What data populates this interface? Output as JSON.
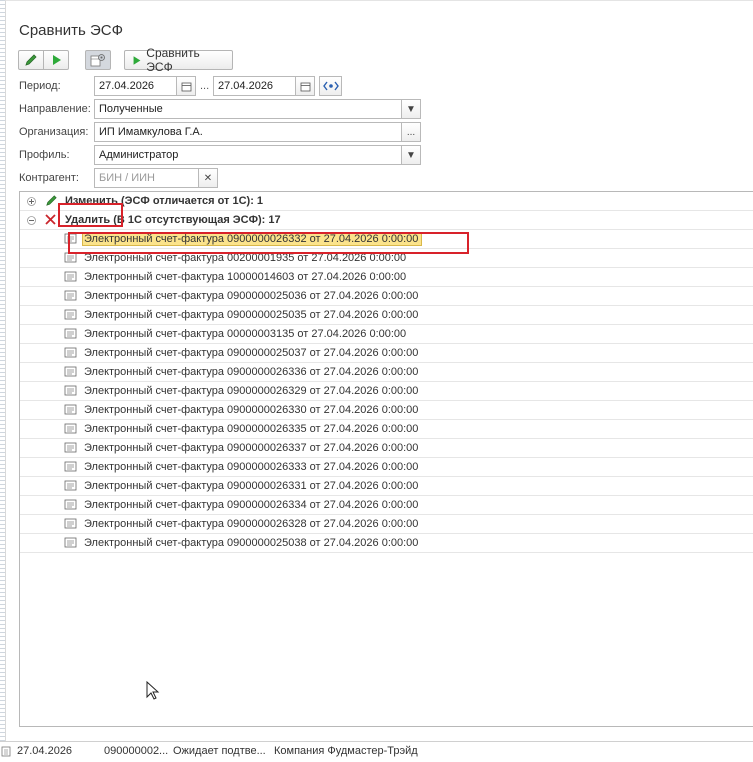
{
  "window": {
    "title": "Сравнить ЭСФ"
  },
  "toolbar": {
    "compare_label": "Сравнить ЭСФ"
  },
  "filters": {
    "period_label": "Период:",
    "period_from": "27.04.2026",
    "period_to": "27.04.2026",
    "period_sep": "...",
    "direction_label": "Направление:",
    "direction_value": "Полученные",
    "org_label": "Организация:",
    "org_value": "ИП Имамкулова Г.А.",
    "profile_label": "Профиль:",
    "profile_value": "Администратор",
    "counterparty_label": "Контрагент:",
    "counterparty_placeholder": "БИН / ИИН"
  },
  "tree": {
    "groups": [
      {
        "label": "Изменить (ЭСФ отличается от 1С): 1",
        "expanded": false
      },
      {
        "label": "Удалить (В 1С отсутствующая ЭСФ): 17",
        "expanded": true
      }
    ],
    "items": [
      "Электронный счет-фактура 0900000026332 от 27.04.2026 0:00:00",
      "Электронный счет-фактура 00200001935 от 27.04.2026 0:00:00",
      "Электронный счет-фактура 10000014603 от 27.04.2026 0:00:00",
      "Электронный счет-фактура 0900000025036 от 27.04.2026 0:00:00",
      "Электронный счет-фактура 0900000025035 от 27.04.2026 0:00:00",
      "Электронный счет-фактура 00000003135 от 27.04.2026 0:00:00",
      "Электронный счет-фактура 0900000025037 от 27.04.2026 0:00:00",
      "Электронный счет-фактура 0900000026336 от 27.04.2026 0:00:00",
      "Электронный счет-фактура 0900000026329 от 27.04.2026 0:00:00",
      "Электронный счет-фактура 0900000026330 от 27.04.2026 0:00:00",
      "Электронный счет-фактура 0900000026335 от 27.04.2026 0:00:00",
      "Электронный счет-фактура 0900000026337 от 27.04.2026 0:00:00",
      "Электронный счет-фактура 0900000026333 от 27.04.2026 0:00:00",
      "Электронный счет-фактура 0900000026331 от 27.04.2026 0:00:00",
      "Электронный счет-фактура 0900000026334 от 27.04.2026 0:00:00",
      "Электронный счет-фактура 0900000026328 от 27.04.2026 0:00:00",
      "Электронный счет-фактура 0900000025038 от 27.04.2026 0:00:00"
    ]
  },
  "statusbar": {
    "date": "27.04.2026",
    "number": "090000002...",
    "status": "Ожидает подтве...",
    "company": "Компания Фудмастер-Трэйд"
  },
  "colors": {
    "accent_green": "#2eaa3a",
    "selection": "#fbe38b",
    "annotation_red": "#d8222a"
  }
}
